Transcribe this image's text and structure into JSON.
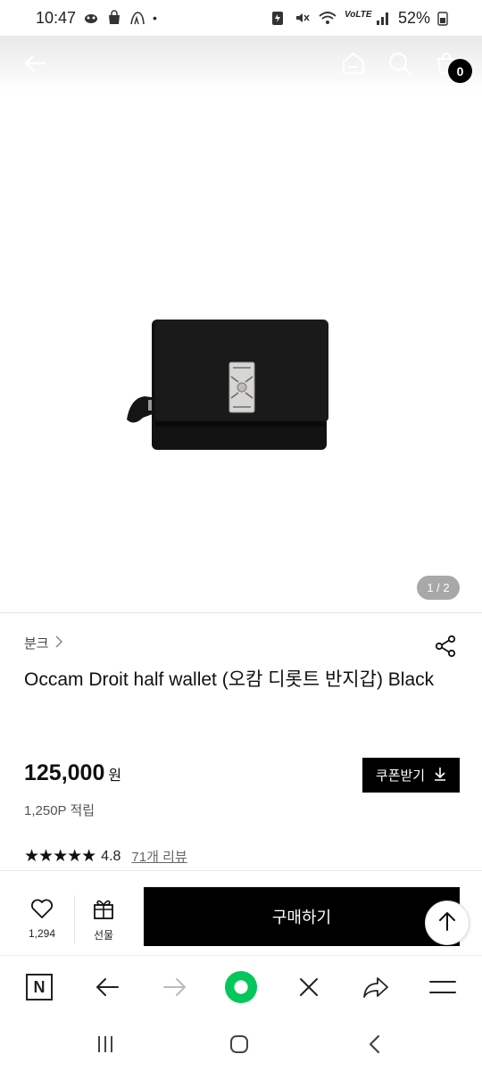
{
  "status_bar": {
    "time": "10:47",
    "battery": "52%",
    "dot": "•"
  },
  "header": {
    "cart_count": "0",
    "icons": [
      "back-arrow-icon",
      "home-icon",
      "search-icon",
      "cart-icon"
    ]
  },
  "gallery": {
    "pager": "1 / 2",
    "image": "wallet-product-image"
  },
  "product": {
    "brand": "분크",
    "title": "Occam Droit half wallet (오캄 디롯트 반지갑) Black",
    "price": "125,000",
    "currency": "원",
    "points": "1,250P 적립",
    "coupon_label": "쿠폰받기",
    "stars": "★★★★★",
    "rating": "4.8",
    "review_label": "71개 리뷰"
  },
  "purchase_bar": {
    "like_count": "1,294",
    "gift_label": "선물",
    "buy_label": "구매하기"
  },
  "browser_bar": {
    "naver_label": "N",
    "home_dot_color": "#03c75a"
  },
  "colors": {
    "primary": "#000000",
    "pager_bg": "#a8a8a8"
  }
}
